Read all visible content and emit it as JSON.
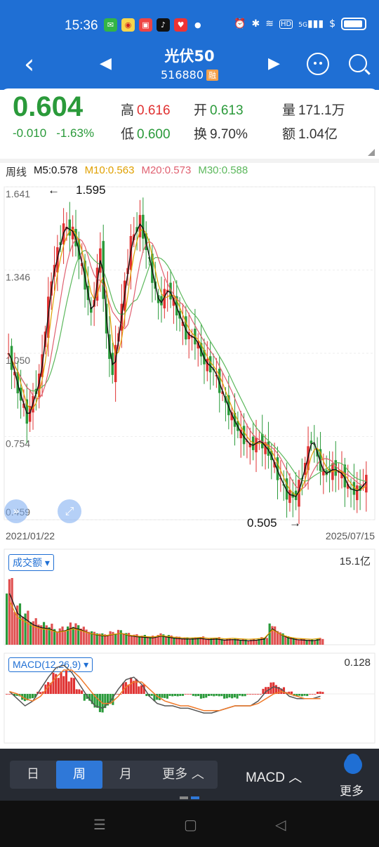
{
  "status_bar": {
    "time": "15:36",
    "app_icons": [
      "wechat-icon",
      "weibo-icon",
      "news-icon",
      "tiktok-icon",
      "heart-app-icon"
    ],
    "icons": [
      "alarm-icon",
      "bluetooth-icon",
      "wifi-icon",
      "hd-icon",
      "5g-signal-icon",
      "dollar-icon",
      "battery-icon"
    ],
    "hd": "HD",
    "signal": "5G"
  },
  "header": {
    "title": "光伏50",
    "code": "516880",
    "badge": "融"
  },
  "quote": {
    "price": "0.604",
    "change": "-0.010",
    "change_pct": "-1.63%",
    "high_label": "高",
    "high": "0.616",
    "open_label": "开",
    "open": "0.613",
    "volume_label": "量",
    "volume": "171.1万",
    "low_label": "低",
    "low": "0.600",
    "turnover_label": "换",
    "turnover": "9.70%",
    "amount_label": "额",
    "amount": "1.04亿",
    "colors": {
      "up": "#e03131",
      "down": "#2a9a3a"
    }
  },
  "ma_legend": {
    "period": "周线",
    "m5": "M5:0.578",
    "m10": "M10:0.563",
    "m20": "M20:0.573",
    "m30": "M30:0.588",
    "colors": {
      "m5": "#111111",
      "m10": "#e0a000",
      "m20": "#e06070",
      "m30": "#5cb85c"
    }
  },
  "chart_data": [
    {
      "type": "candlestick",
      "title": "",
      "y_ticks": [
        "1.641",
        "1.346",
        "1.050",
        "0.754",
        "0.459"
      ],
      "ylim": [
        0.459,
        1.641
      ],
      "x_range": [
        "2021/01/22",
        "2025/07/15"
      ],
      "annotations": {
        "high": "1.595",
        "low": "0.505",
        "high_arrow": "←",
        "low_arrow": "→"
      },
      "grid": true,
      "trend_points": [
        [
          0,
          1.05
        ],
        [
          3,
          0.92
        ],
        [
          6,
          0.82
        ],
        [
          10,
          0.96
        ],
        [
          14,
          1.32
        ],
        [
          18,
          1.5
        ],
        [
          21,
          1.48
        ],
        [
          24,
          1.35
        ],
        [
          27,
          1.18
        ],
        [
          30,
          1.42
        ],
        [
          32,
          1.1
        ],
        [
          34,
          0.98
        ],
        [
          37,
          1.22
        ],
        [
          40,
          1.45
        ],
        [
          43,
          1.52
        ],
        [
          46,
          1.37
        ],
        [
          49,
          1.22
        ],
        [
          52,
          1.28
        ],
        [
          55,
          1.2
        ],
        [
          58,
          1.12
        ],
        [
          61,
          1.1
        ],
        [
          64,
          1.02
        ],
        [
          67,
          0.99
        ],
        [
          70,
          0.9
        ],
        [
          73,
          0.82
        ],
        [
          76,
          0.76
        ],
        [
          79,
          0.72
        ],
        [
          82,
          0.74
        ],
        [
          85,
          0.7
        ],
        [
          88,
          0.62
        ],
        [
          91,
          0.55
        ],
        [
          94,
          0.54
        ],
        [
          97,
          0.66
        ],
        [
          99,
          0.75
        ],
        [
          101,
          0.68
        ],
        [
          103,
          0.62
        ],
        [
          106,
          0.64
        ],
        [
          109,
          0.62
        ],
        [
          111,
          0.57
        ],
        [
          114,
          0.56
        ],
        [
          117,
          0.6
        ]
      ]
    },
    {
      "type": "bar",
      "title": "成交额",
      "max_label": "15.1亿",
      "ma_colors": [
        "#111111",
        "#e0a000"
      ],
      "relative_values": [
        0.9,
        0.55,
        0.45,
        0.35,
        0.3,
        0.28,
        0.22,
        0.25,
        0.3,
        0.26,
        0.2,
        0.17,
        0.15,
        0.18,
        0.2,
        0.16,
        0.14,
        0.13,
        0.12,
        0.15,
        0.13,
        0.11,
        0.1,
        0.1,
        0.11,
        0.09,
        0.1,
        0.08,
        0.09,
        0.08,
        0.07,
        0.08,
        0.1,
        0.28,
        0.18,
        0.12,
        0.09,
        0.08,
        0.07,
        0.09
      ]
    },
    {
      "type": "macd",
      "title": "MACD(12,26,9)",
      "max_label": "0.128",
      "histogram": [
        0.0,
        -0.01,
        -0.03,
        -0.02,
        0.01,
        0.05,
        0.09,
        0.1,
        0.07,
        0.02,
        -0.03,
        -0.06,
        -0.08,
        -0.05,
        0.0,
        0.05,
        0.07,
        0.04,
        -0.01,
        -0.03,
        -0.02,
        -0.01,
        -0.01,
        0.0,
        -0.01,
        -0.02,
        -0.01,
        -0.01,
        -0.02,
        -0.02,
        -0.01,
        0.0,
        0.0,
        0.03,
        0.05,
        0.03,
        0.01,
        -0.01,
        -0.01,
        0.0,
        0.01
      ],
      "dif": [
        0.01,
        -0.02,
        -0.05,
        -0.03,
        0.02,
        0.07,
        0.11,
        0.12,
        0.09,
        0.04,
        -0.01,
        -0.05,
        -0.06,
        -0.03,
        0.02,
        0.06,
        0.07,
        0.04,
        -0.01,
        -0.04,
        -0.05,
        -0.05,
        -0.06,
        -0.06,
        -0.07,
        -0.08,
        -0.08,
        -0.07,
        -0.06,
        -0.05,
        -0.05,
        -0.05,
        -0.03,
        0.01,
        0.03,
        0.02,
        -0.01,
        -0.02,
        -0.02,
        -0.02,
        -0.01
      ],
      "dea": [
        0.01,
        0.0,
        -0.02,
        -0.03,
        -0.01,
        0.03,
        0.07,
        0.1,
        0.1,
        0.07,
        0.03,
        -0.01,
        -0.04,
        -0.04,
        -0.01,
        0.03,
        0.05,
        0.05,
        0.02,
        -0.01,
        -0.03,
        -0.04,
        -0.05,
        -0.05,
        -0.06,
        -0.07,
        -0.07,
        -0.07,
        -0.06,
        -0.05,
        -0.05,
        -0.05,
        -0.04,
        -0.02,
        0.0,
        0.01,
        0.0,
        -0.01,
        -0.02,
        -0.02,
        -0.02
      ],
      "colors": {
        "dif": "#555555",
        "dea": "#f07a2a",
        "up": "#e03131",
        "down": "#2a9a3a"
      }
    }
  ],
  "toolbar": {
    "periods": [
      "日",
      "周",
      "月"
    ],
    "active": "周",
    "more": "更多 ︿",
    "indicator": "MACD ︿",
    "more_label": "更多"
  },
  "sysnav": {
    "menu": "☰",
    "home": "▢",
    "back": "◁"
  }
}
